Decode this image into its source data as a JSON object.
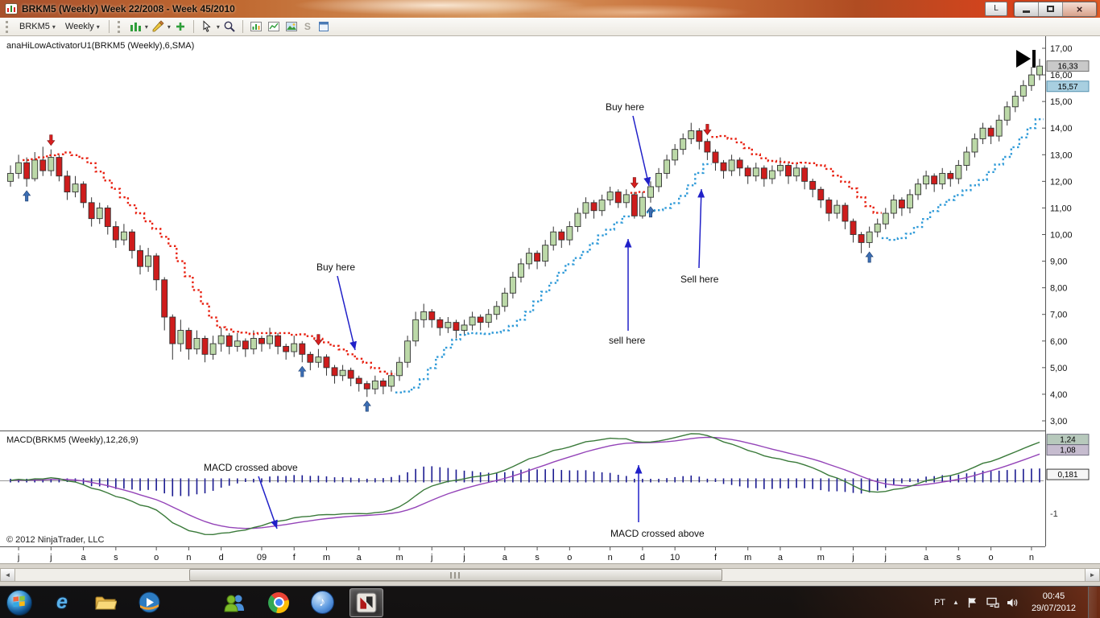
{
  "window": {
    "title": "BRKM5 (Weekly)  Week 22/2008 - Week 45/2010",
    "l_button": "L",
    "close_glyph": "×"
  },
  "toolbar": {
    "instrument": "BRKM5",
    "interval": "Weekly",
    "dropdown_glyph": "▾",
    "snap_label": "S"
  },
  "scrollbar": {
    "left_glyph": "◄",
    "right_glyph": "►"
  },
  "chart": {
    "indicator_label": "anaHiLowActivatorU1(BRKM5 (Weekly),6,SMA)",
    "macd_label": "MACD(BRKM5 (Weekly),12,26,9)",
    "copyright": "© 2012 NinjaTrader, LLC",
    "price_axis_labels": [
      "17,00",
      "16,00",
      "15,00",
      "14,00",
      "13,00",
      "12,00",
      "11,00",
      "10,00",
      "9,00",
      "8,00",
      "7,00",
      "6,00",
      "5,00",
      "4,00",
      "3,00"
    ],
    "last_price_box": "16,33",
    "activator_price_box": "15,57",
    "macd_value_boxes": [
      "1,24",
      "1,08",
      "0,181"
    ],
    "macd_axis_label": "-1"
  },
  "chart_data": {
    "type": "candlestick",
    "title": "BRKM5 (Weekly)  Week 22/2008 - Week 45/2010",
    "ylim": [
      3,
      17
    ],
    "price_ticks": [
      17,
      16,
      15,
      14,
      13,
      12,
      11,
      10,
      9,
      8,
      7,
      6,
      5,
      4,
      3
    ],
    "candles": [
      [
        12.0,
        12.6,
        11.8,
        12.3
      ],
      [
        12.3,
        13.0,
        12.1,
        12.7
      ],
      [
        12.7,
        12.9,
        11.8,
        12.1
      ],
      [
        12.1,
        13.1,
        12.0,
        12.8
      ],
      [
        12.8,
        13.3,
        12.2,
        12.4
      ],
      [
        12.4,
        13.2,
        12.2,
        12.9
      ],
      [
        12.9,
        13.0,
        12.0,
        12.2
      ],
      [
        12.2,
        12.4,
        11.3,
        11.6
      ],
      [
        11.6,
        12.2,
        11.4,
        11.9
      ],
      [
        11.9,
        12.0,
        11.0,
        11.2
      ],
      [
        11.2,
        11.4,
        10.3,
        10.6
      ],
      [
        10.6,
        11.2,
        10.4,
        11.0
      ],
      [
        11.0,
        11.1,
        10.0,
        10.3
      ],
      [
        10.3,
        10.5,
        9.5,
        9.8
      ],
      [
        9.8,
        10.4,
        9.6,
        10.1
      ],
      [
        10.1,
        10.2,
        9.1,
        9.4
      ],
      [
        9.4,
        9.6,
        8.5,
        8.8
      ],
      [
        8.8,
        9.5,
        8.6,
        9.2
      ],
      [
        9.2,
        9.3,
        7.9,
        8.3
      ],
      [
        8.3,
        8.4,
        6.4,
        6.9
      ],
      [
        6.9,
        7.0,
        5.3,
        5.9
      ],
      [
        5.9,
        6.8,
        5.6,
        6.4
      ],
      [
        6.4,
        6.5,
        5.3,
        5.7
      ],
      [
        5.7,
        6.4,
        5.5,
        6.1
      ],
      [
        6.1,
        6.2,
        5.2,
        5.5
      ],
      [
        5.5,
        6.2,
        5.3,
        5.9
      ],
      [
        5.9,
        6.5,
        5.6,
        6.2
      ],
      [
        6.2,
        6.3,
        5.5,
        5.8
      ],
      [
        5.8,
        6.3,
        5.6,
        6.0
      ],
      [
        6.0,
        6.1,
        5.4,
        5.7
      ],
      [
        5.7,
        6.4,
        5.5,
        6.1
      ],
      [
        6.1,
        6.2,
        5.6,
        5.9
      ],
      [
        5.9,
        6.5,
        5.7,
        6.2
      ],
      [
        6.2,
        6.3,
        5.5,
        5.8
      ],
      [
        5.8,
        5.9,
        5.3,
        5.6
      ],
      [
        5.6,
        6.2,
        5.4,
        5.9
      ],
      [
        5.9,
        6.0,
        5.2,
        5.5
      ],
      [
        5.5,
        5.6,
        4.9,
        5.2
      ],
      [
        5.2,
        5.7,
        5.0,
        5.4
      ],
      [
        5.4,
        5.5,
        4.7,
        5.0
      ],
      [
        5.0,
        5.1,
        4.4,
        4.7
      ],
      [
        4.7,
        5.1,
        4.5,
        4.9
      ],
      [
        4.9,
        5.0,
        4.3,
        4.6
      ],
      [
        4.6,
        4.7,
        4.1,
        4.4
      ],
      [
        4.4,
        4.5,
        3.9,
        4.2
      ],
      [
        4.2,
        4.7,
        4.0,
        4.5
      ],
      [
        4.5,
        4.6,
        4.0,
        4.3
      ],
      [
        4.3,
        4.9,
        4.1,
        4.7
      ],
      [
        4.7,
        5.4,
        4.5,
        5.2
      ],
      [
        5.2,
        6.2,
        5.0,
        6.0
      ],
      [
        6.0,
        7.1,
        5.8,
        6.8
      ],
      [
        6.8,
        7.4,
        6.5,
        7.1
      ],
      [
        7.1,
        7.2,
        6.5,
        6.8
      ],
      [
        6.8,
        6.9,
        6.2,
        6.5
      ],
      [
        6.5,
        6.9,
        6.3,
        6.7
      ],
      [
        6.7,
        6.8,
        6.1,
        6.4
      ],
      [
        6.4,
        6.8,
        6.2,
        6.6
      ],
      [
        6.6,
        7.1,
        6.4,
        6.9
      ],
      [
        6.9,
        7.0,
        6.4,
        6.7
      ],
      [
        6.7,
        7.2,
        6.5,
        7.0
      ],
      [
        7.0,
        7.5,
        6.8,
        7.3
      ],
      [
        7.3,
        8.0,
        7.1,
        7.8
      ],
      [
        7.8,
        8.6,
        7.6,
        8.4
      ],
      [
        8.4,
        9.1,
        8.2,
        8.9
      ],
      [
        8.9,
        9.5,
        8.7,
        9.3
      ],
      [
        9.3,
        9.4,
        8.7,
        9.0
      ],
      [
        9.0,
        9.8,
        8.8,
        9.6
      ],
      [
        9.6,
        10.3,
        9.4,
        10.1
      ],
      [
        10.1,
        10.2,
        9.5,
        9.8
      ],
      [
        9.8,
        10.5,
        9.6,
        10.3
      ],
      [
        10.3,
        11.0,
        10.1,
        10.8
      ],
      [
        10.8,
        11.4,
        10.6,
        11.2
      ],
      [
        11.2,
        11.3,
        10.6,
        10.9
      ],
      [
        10.9,
        11.5,
        10.7,
        11.3
      ],
      [
        11.3,
        11.8,
        11.1,
        11.6
      ],
      [
        11.6,
        11.7,
        11.0,
        11.2
      ],
      [
        11.2,
        11.7,
        11.0,
        11.5
      ],
      [
        11.5,
        11.6,
        10.6,
        10.7
      ],
      [
        10.7,
        11.6,
        10.6,
        11.4
      ],
      [
        11.4,
        12.0,
        11.2,
        11.8
      ],
      [
        11.8,
        12.5,
        11.6,
        12.3
      ],
      [
        12.3,
        13.0,
        12.1,
        12.8
      ],
      [
        12.8,
        13.4,
        12.6,
        13.2
      ],
      [
        13.2,
        13.8,
        13.0,
        13.6
      ],
      [
        13.6,
        14.2,
        13.4,
        13.9
      ],
      [
        13.9,
        14.0,
        13.2,
        13.5
      ],
      [
        13.5,
        13.6,
        12.8,
        13.1
      ],
      [
        13.1,
        13.2,
        12.4,
        12.7
      ],
      [
        12.7,
        12.8,
        12.1,
        12.4
      ],
      [
        12.4,
        13.0,
        12.2,
        12.8
      ],
      [
        12.8,
        12.9,
        12.2,
        12.5
      ],
      [
        12.5,
        12.6,
        11.9,
        12.2
      ],
      [
        12.2,
        12.7,
        12.0,
        12.5
      ],
      [
        12.5,
        12.6,
        11.8,
        12.1
      ],
      [
        12.1,
        12.6,
        11.9,
        12.4
      ],
      [
        12.4,
        12.9,
        12.2,
        12.6
      ],
      [
        12.6,
        12.7,
        11.9,
        12.2
      ],
      [
        12.2,
        12.7,
        12.0,
        12.5
      ],
      [
        12.5,
        12.6,
        11.7,
        12.0
      ],
      [
        12.0,
        12.1,
        11.4,
        11.7
      ],
      [
        11.7,
        11.8,
        11.0,
        11.3
      ],
      [
        11.3,
        11.4,
        10.5,
        10.8
      ],
      [
        10.8,
        11.3,
        10.6,
        11.1
      ],
      [
        11.1,
        11.2,
        10.2,
        10.5
      ],
      [
        10.5,
        10.6,
        9.7,
        10.0
      ],
      [
        10.0,
        10.1,
        9.3,
        9.7
      ],
      [
        9.7,
        10.3,
        9.5,
        10.1
      ],
      [
        10.1,
        10.6,
        9.9,
        10.4
      ],
      [
        10.4,
        11.0,
        10.2,
        10.8
      ],
      [
        10.8,
        11.5,
        10.6,
        11.3
      ],
      [
        11.3,
        11.4,
        10.7,
        11.0
      ],
      [
        11.0,
        11.7,
        10.8,
        11.5
      ],
      [
        11.5,
        12.1,
        11.3,
        11.9
      ],
      [
        11.9,
        12.4,
        11.7,
        12.2
      ],
      [
        12.2,
        12.3,
        11.6,
        11.9
      ],
      [
        11.9,
        12.5,
        11.7,
        12.3
      ],
      [
        12.3,
        12.4,
        11.8,
        12.1
      ],
      [
        12.1,
        12.8,
        11.9,
        12.6
      ],
      [
        12.6,
        13.3,
        12.4,
        13.1
      ],
      [
        13.1,
        13.8,
        12.9,
        13.6
      ],
      [
        13.6,
        14.2,
        13.4,
        14.0
      ],
      [
        14.0,
        14.1,
        13.4,
        13.7
      ],
      [
        13.7,
        14.5,
        13.5,
        14.3
      ],
      [
        14.3,
        15.0,
        14.1,
        14.8
      ],
      [
        14.8,
        15.4,
        14.6,
        15.2
      ],
      [
        15.2,
        15.8,
        15.0,
        15.6
      ],
      [
        15.6,
        16.3,
        15.4,
        16.0
      ],
      [
        16.0,
        16.6,
        15.8,
        16.33
      ]
    ],
    "x_labels": [
      [
        "j",
        1
      ],
      [
        "j",
        5
      ],
      [
        "a",
        9
      ],
      [
        "s",
        13
      ],
      [
        "o",
        18
      ],
      [
        "n",
        22
      ],
      [
        "d",
        26
      ],
      [
        "09",
        31
      ],
      [
        "f",
        35
      ],
      [
        "m",
        39
      ],
      [
        "a",
        43
      ],
      [
        "m",
        48
      ],
      [
        "j",
        52
      ],
      [
        "j",
        56
      ],
      [
        "a",
        61
      ],
      [
        "s",
        65
      ],
      [
        "o",
        69
      ],
      [
        "n",
        74
      ],
      [
        "d",
        78
      ],
      [
        "10",
        82
      ],
      [
        "f",
        87
      ],
      [
        "m",
        91
      ],
      [
        "a",
        95
      ],
      [
        "m",
        100
      ],
      [
        "j",
        104
      ],
      [
        "j",
        108
      ],
      [
        "a",
        113
      ],
      [
        "s",
        117
      ],
      [
        "o",
        121
      ],
      [
        "n",
        126
      ]
    ],
    "sell_arrow_bars": [
      5,
      38,
      77,
      86
    ],
    "buy_arrow_bars": [
      2,
      36,
      44,
      79,
      106
    ],
    "sell_arrow_color": "#d81f1f",
    "buy_arrow_color": "#3c6eb4",
    "overlay": {
      "name": "anaHiLowActivatorU1",
      "period": 6,
      "method": "SMA",
      "up_color": "#2f9ad8",
      "down_color": "#e82010"
    },
    "macd": {
      "fast": 12,
      "slow": 26,
      "smooth": 9,
      "line_color": "#3a7a3a",
      "signal_color": "#9444b8",
      "hist_color": "#1a1a90",
      "axis_label_value": -1
    },
    "annotations": [
      {
        "text": "Buy here",
        "tx": 752,
        "ty": 92,
        "x1": 786,
        "y1": 99,
        "x2": 806,
        "y2": 186
      },
      {
        "text": "Buy here",
        "tx": 393,
        "ty": 291,
        "x1": 419,
        "y1": 298,
        "x2": 441,
        "y2": 390
      },
      {
        "text": "sell here",
        "tx": 756,
        "ty": 382,
        "x1": 780,
        "y1": 366,
        "x2": 780,
        "y2": 252
      },
      {
        "text": "Sell here",
        "tx": 845,
        "ty": 306,
        "x1": 868,
        "y1": 288,
        "x2": 871,
        "y2": 190
      },
      {
        "text": "MACD crossed above",
        "tx": 253,
        "ty": 540,
        "x1": 321,
        "y1": 547,
        "x2": 344,
        "y2": 612
      },
      {
        "text": "MACD crossed above",
        "tx": 758,
        "ty": 622,
        "x1": 793,
        "y1": 604,
        "x2": 793,
        "y2": 533
      }
    ]
  },
  "taskbar": {
    "language": "PT",
    "hidden_icons_glyph": "▲",
    "ie_glyph": "e",
    "itunes_glyph": "♪",
    "time": "00:45",
    "date": "29/07/2012"
  }
}
